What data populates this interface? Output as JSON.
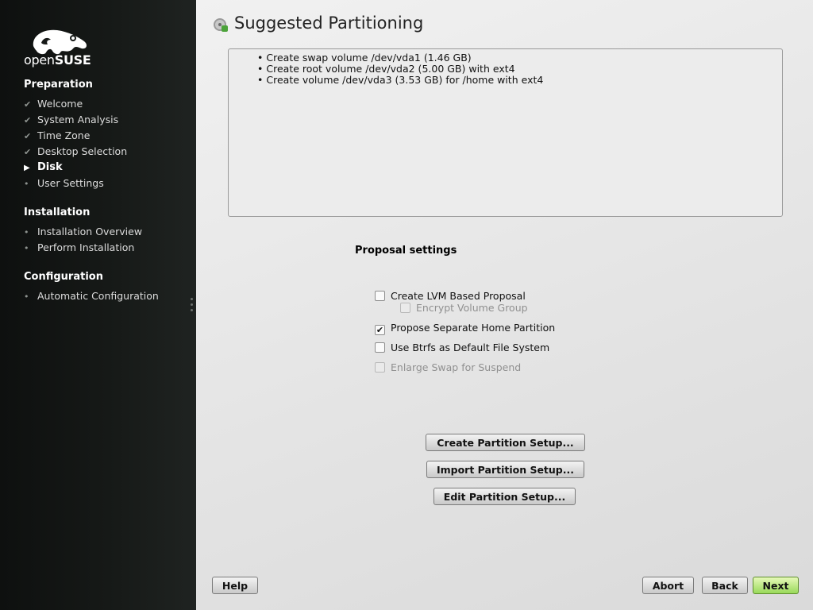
{
  "brand": {
    "name_light": "open",
    "name_bold": "SUSE"
  },
  "sidebar": {
    "sections": [
      {
        "title": "Preparation",
        "items": [
          {
            "label": "Welcome",
            "state": "done"
          },
          {
            "label": "System Analysis",
            "state": "done"
          },
          {
            "label": "Time Zone",
            "state": "done"
          },
          {
            "label": "Desktop Selection",
            "state": "done"
          },
          {
            "label": "Disk",
            "state": "current"
          },
          {
            "label": "User Settings",
            "state": "pending"
          }
        ]
      },
      {
        "title": "Installation",
        "items": [
          {
            "label": "Installation Overview",
            "state": "pending"
          },
          {
            "label": "Perform Installation",
            "state": "pending"
          }
        ]
      },
      {
        "title": "Configuration",
        "items": [
          {
            "label": "Automatic Configuration",
            "state": "pending"
          }
        ]
      }
    ]
  },
  "main": {
    "title": "Suggested Partitioning",
    "summary": [
      "Create swap volume /dev/vda1 (1.46 GB)",
      "Create root volume /dev/vda2 (5.00 GB) with ext4",
      "Create volume /dev/vda3 (3.53 GB) for /home with ext4"
    ],
    "proposal_title": "Proposal settings",
    "options": {
      "lvm": {
        "label": "Create LVM Based Proposal",
        "checked": false,
        "enabled": true
      },
      "encrypt": {
        "label": "Encrypt Volume Group",
        "checked": false,
        "enabled": false
      },
      "home": {
        "label": "Propose Separate Home Partition",
        "checked": true,
        "enabled": true
      },
      "btrfs": {
        "label": "Use Btrfs as Default File System",
        "checked": false,
        "enabled": true
      },
      "swap": {
        "label": "Enlarge Swap for Suspend",
        "checked": false,
        "enabled": false
      }
    },
    "buttons": {
      "create": "Create Partition Setup...",
      "import": "Import Partition Setup...",
      "edit": "Edit Partition Setup..."
    }
  },
  "footer": {
    "help": "Help",
    "abort": "Abort",
    "back": "Back",
    "next": "Next"
  },
  "colors": {
    "sidebar_bg": "#161917",
    "next_button": "#99d95a"
  }
}
